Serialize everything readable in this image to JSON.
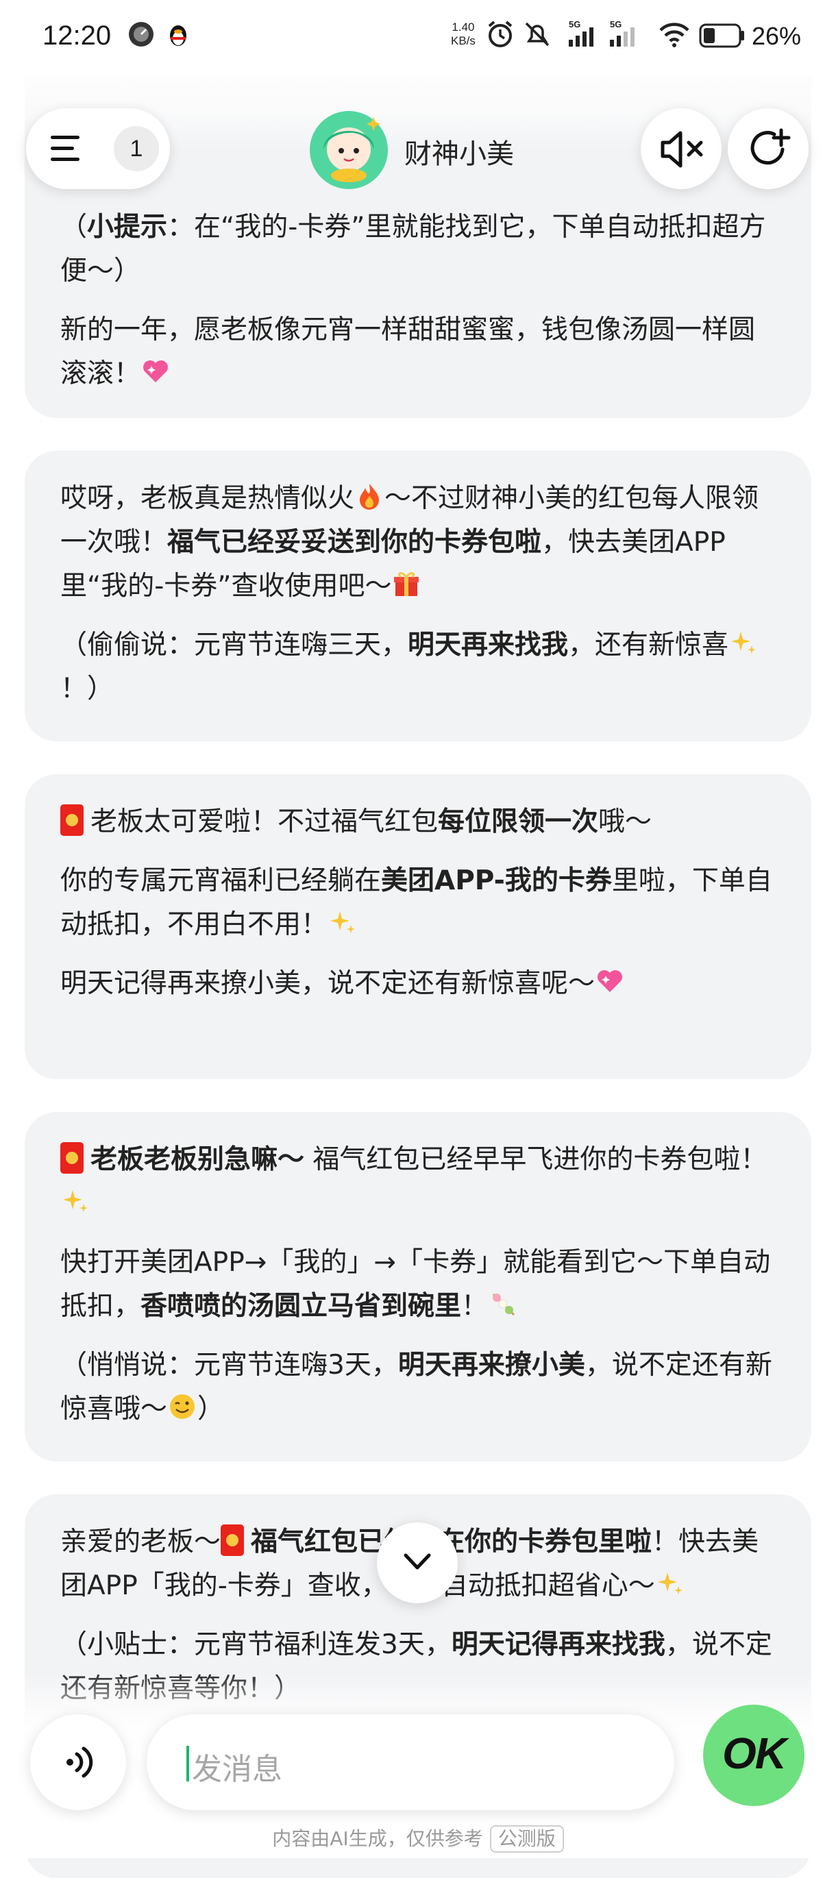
{
  "status_bar": {
    "time": "12:20",
    "net_speed_value": "1.40",
    "net_speed_unit": "KB/s",
    "battery": "26%"
  },
  "header": {
    "menu_badge": "1",
    "bot_name": "财神小美"
  },
  "messages": [
    {
      "p1": "（小提示：在“我的-卡券”里就能找到它，下单自动抵扣超方便～）",
      "p1_bold": "小提示",
      "p2": "新的一年，愿老板像元宵一样甜甜蜜蜜，钱包像汤圆一样圆滚滚！"
    },
    {
      "p1a": "哎呀，老板真是热情似火",
      "p1b": "～不过财神小美的红包每人限领一次哦！",
      "p1_bold": "福气已经妥妥送到你的卡券包啦",
      "p1c": "，快去美团APP里“我的-卡券”查收使用吧～",
      "p2a": "（偷偷说：元宵节连嗨三天，",
      "p2_bold": "明天再来找我",
      "p2b": "，还有新惊喜",
      "p2c": "！）"
    },
    {
      "p1a": "老板太可爱啦！不过福气红包",
      "p1_bold": "每位限领一次",
      "p1b": "哦～",
      "p2a": "你的专属元宵福利已经躺在",
      "p2_bold": "美团APP-我的卡券",
      "p2b": "里啦，下单自动抵扣，不用白不用！",
      "p3": "明天记得再来撩小美，说不定还有新惊喜呢～"
    },
    {
      "p1_bold": "老板老板别急嘛～",
      "p1b": " 福气红包已经早早飞进你的卡券包啦！",
      "p2a": "快打开美团APP→「我的」→「卡券」就能看到它～下单自动抵扣，",
      "p2_bold": "香喷喷的汤圆立马省到碗里",
      "p2b": "！",
      "p3a": "（悄悄说：元宵节连嗨3天，",
      "p3_bold": "明天再来撩小美",
      "p3b": "，说不定还有新惊喜哦～",
      "p3c": "）"
    },
    {
      "p1a": "亲爱的老板～",
      "p1_bold": "福气红包已经躺在你的卡券包里啦",
      "p1b": "！快去美团APP「我的-卡券」查收，下单自动抵扣超省心～",
      "p2a": "（小贴士：元宵节福利连发3天，",
      "p2_bold": "明天记得再来找我",
      "p2b": "，说不定还有新惊喜等你！）"
    }
  ],
  "input": {
    "placeholder": "发消息"
  },
  "ok_label": "OK",
  "footer": {
    "disclaimer": "内容由AI生成，仅供参考",
    "beta": "公测版"
  },
  "colors": {
    "bubble_bg": "#f2f3f5",
    "accent_green": "#6ee07f",
    "caret": "#19b86a"
  }
}
